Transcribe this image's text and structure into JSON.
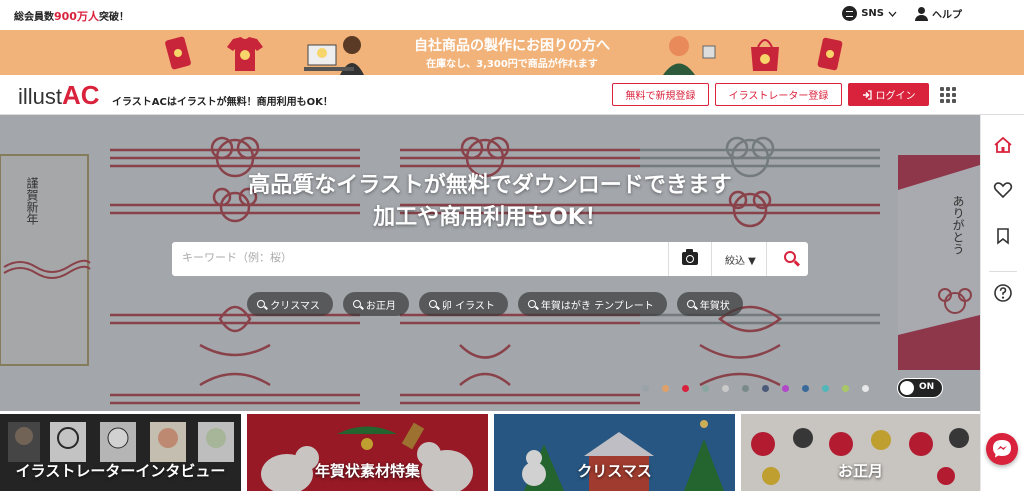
{
  "topbar": {
    "members_prefix": "総会員数",
    "members_count": "900万人",
    "members_suffix": "突破！",
    "sns_label": "SNS",
    "help_label": "ヘルプ"
  },
  "banner": {
    "line1": "自社商品の製作にお困りの方へ",
    "line2": "在庫なし、3,300円で商品が作れます"
  },
  "header": {
    "logo_main": "illust",
    "logo_accent": "AC",
    "tagline": "イラストACはイラストが無料！商用利用もOK！",
    "register_free": "無料で新規登録",
    "register_illustrator": "イラストレーター登録",
    "login": "ログイン"
  },
  "hero": {
    "title_line1": "高品質なイラストが無料でダウンロードできます",
    "title_line2": "加工や商用利用もOK！",
    "left_card_text": "謹賀新年",
    "right_card_text": "ありがとう",
    "search_placeholder": "キーワード（例：桜）",
    "narrow_label": "絞込 ▼",
    "chips": [
      "クリスマス",
      "お正月",
      "卯 イラスト",
      "年賀はがき テンプレート",
      "年賀状"
    ],
    "dot_colors": [
      "#9aa3a8",
      "#e0a06a",
      "#d9223b",
      "#8aa6a0",
      "#c9c9c9",
      "#7a8a8a",
      "#4c5a7a",
      "#b048c8",
      "#3a6a9a",
      "#50b8b8",
      "#a8c868",
      "#e8e8e8"
    ],
    "toggle_label": "ON"
  },
  "categories": [
    {
      "label": "イラストレーターインタビュー"
    },
    {
      "label": "年賀状素材特集"
    },
    {
      "label": "クリスマス"
    },
    {
      "label": "お正月"
    }
  ],
  "colors": {
    "brand_red": "#d9223b",
    "banner_orange": "#f2b37a"
  }
}
